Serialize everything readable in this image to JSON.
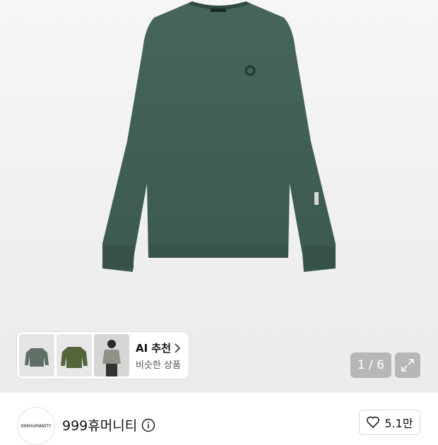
{
  "recommendation": {
    "title": "AI 추천",
    "subtitle": "비슷한 상품"
  },
  "gallery": {
    "counter": "1 / 6"
  },
  "brand": {
    "logo_text": "999HUMANITY",
    "name": "999휴머니티"
  },
  "like": {
    "count": "5.1만"
  },
  "colors": {
    "shirt": "#3f5e55",
    "shirt_dark": "#344f47",
    "thumb_olive": "#5b6a40"
  },
  "icons": [
    "info-icon",
    "heart-icon",
    "expand-icon",
    "chevron-right-icon"
  ]
}
